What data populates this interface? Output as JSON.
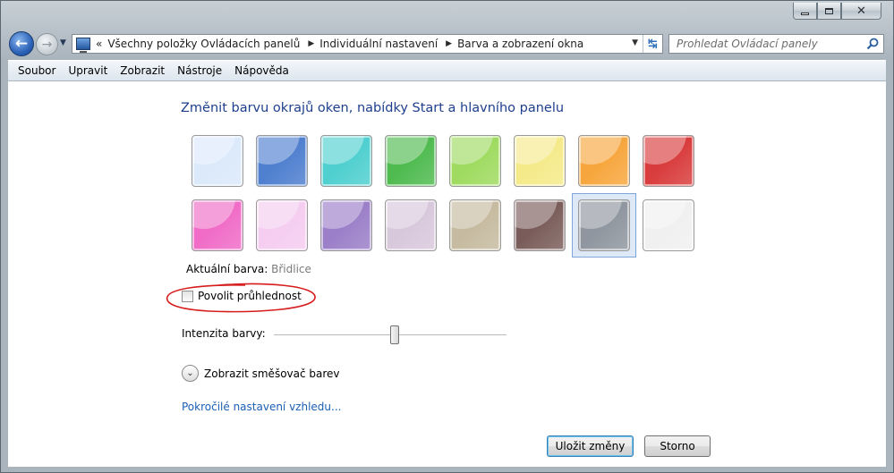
{
  "window": {
    "caption_buttons": {
      "minimize_icon": "minimize-icon",
      "maximize_icon": "maximize-icon",
      "close_icon": "close-icon"
    }
  },
  "nav": {
    "back_icon": "arrow-left-icon",
    "forward_icon": "arrow-right-icon",
    "overflow": "«",
    "breadcrumbs": [
      "Všechny položky Ovládacích panelů",
      "Individuální nastavení",
      "Barva a zobrazení okna"
    ]
  },
  "search": {
    "placeholder": "Prohledat Ovládací panely"
  },
  "menu": [
    "Soubor",
    "Upravit",
    "Zobrazit",
    "Nástroje",
    "Nápověda"
  ],
  "main": {
    "heading": "Změnit barvu okrajů oken, nabídky Start a hlavního panelu",
    "swatches": [
      {
        "color": "#dbe9fa",
        "selected": false
      },
      {
        "color": "#4f7fcf",
        "selected": false
      },
      {
        "color": "#4fcfcf",
        "selected": false
      },
      {
        "color": "#4fbb4f",
        "selected": false
      },
      {
        "color": "#9fdb60",
        "selected": false
      },
      {
        "color": "#f5ea8a",
        "selected": false
      },
      {
        "color": "#f7a63d",
        "selected": false
      },
      {
        "color": "#d93c3c",
        "selected": false
      },
      {
        "color": "#f06cc7",
        "selected": false
      },
      {
        "color": "#f5cdf0",
        "selected": false
      },
      {
        "color": "#9b7fc8",
        "selected": false
      },
      {
        "color": "#d8c8dc",
        "selected": false
      },
      {
        "color": "#c6bba0",
        "selected": false
      },
      {
        "color": "#7a5d5a",
        "selected": false
      },
      {
        "color": "#8f969f",
        "selected": true
      },
      {
        "color": "#f0f0f0",
        "selected": false
      }
    ],
    "current_color_label": "Aktuální barva:",
    "current_color_value": "Břidlice",
    "transparency_label": "Povolit průhlednost",
    "transparency_checked": false,
    "intensity_label": "Intenzita barvy:",
    "intensity_value_fraction": 0.52,
    "mixer_label": "Zobrazit směšovač barev",
    "advanced_link": "Pokročilé nastavení vzhledu..."
  },
  "buttons": {
    "save": "Uložit změny",
    "cancel": "Storno"
  }
}
